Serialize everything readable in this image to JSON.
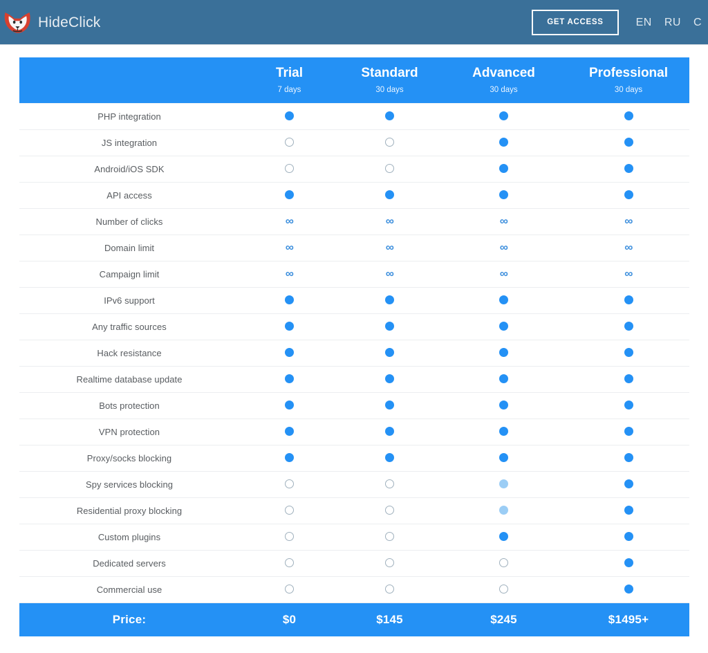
{
  "navbar": {
    "brand_name": "HideClick",
    "logo_icon": "fox-head-logo-icon",
    "cta_label": "GET ACCESS",
    "languages": [
      "EN",
      "RU",
      "C"
    ],
    "background_color": "#3a7099"
  },
  "pricing_table": {
    "accent_color": "#2491f5",
    "partial_color": "#9bcdf5",
    "empty_marker_color": "#9fb0bd",
    "feature_column_header": "",
    "plans": [
      {
        "name": "Trial",
        "duration": "7 days",
        "price": "$0"
      },
      {
        "name": "Standard",
        "duration": "30 days",
        "price": "$145"
      },
      {
        "name": "Advanced",
        "duration": "30 days",
        "price": "$245"
      },
      {
        "name": "Professional",
        "duration": "30 days",
        "price": "$1495+"
      }
    ],
    "price_row_label": "Price:",
    "marker_legend": {
      "full": "included",
      "partial": "partially included",
      "empty": "not included",
      "infinity": "unlimited"
    },
    "rows": [
      {
        "feature": "PHP integration",
        "values": [
          "full",
          "full",
          "full",
          "full"
        ]
      },
      {
        "feature": "JS integration",
        "values": [
          "empty",
          "empty",
          "full",
          "full"
        ]
      },
      {
        "feature": "Android/iOS SDK",
        "values": [
          "empty",
          "empty",
          "full",
          "full"
        ]
      },
      {
        "feature": "API access",
        "values": [
          "full",
          "full",
          "full",
          "full"
        ]
      },
      {
        "feature": "Number of clicks",
        "values": [
          "infinity",
          "infinity",
          "infinity",
          "infinity"
        ]
      },
      {
        "feature": "Domain limit",
        "values": [
          "infinity",
          "infinity",
          "infinity",
          "infinity"
        ]
      },
      {
        "feature": "Campaign limit",
        "values": [
          "infinity",
          "infinity",
          "infinity",
          "infinity"
        ]
      },
      {
        "feature": "IPv6 support",
        "values": [
          "full",
          "full",
          "full",
          "full"
        ]
      },
      {
        "feature": "Any traffic sources",
        "values": [
          "full",
          "full",
          "full",
          "full"
        ]
      },
      {
        "feature": "Hack resistance",
        "values": [
          "full",
          "full",
          "full",
          "full"
        ]
      },
      {
        "feature": "Realtime database update",
        "values": [
          "full",
          "full",
          "full",
          "full"
        ]
      },
      {
        "feature": "Bots protection",
        "values": [
          "full",
          "full",
          "full",
          "full"
        ]
      },
      {
        "feature": "VPN protection",
        "values": [
          "full",
          "full",
          "full",
          "full"
        ]
      },
      {
        "feature": "Proxy/socks blocking",
        "values": [
          "full",
          "full",
          "full",
          "full"
        ]
      },
      {
        "feature": "Spy services blocking",
        "values": [
          "empty",
          "empty",
          "partial",
          "full"
        ]
      },
      {
        "feature": "Residential proxy blocking",
        "values": [
          "empty",
          "empty",
          "partial",
          "full"
        ]
      },
      {
        "feature": "Custom plugins",
        "values": [
          "empty",
          "empty",
          "full",
          "full"
        ]
      },
      {
        "feature": "Dedicated servers",
        "values": [
          "empty",
          "empty",
          "empty",
          "full"
        ]
      },
      {
        "feature": "Commercial use",
        "values": [
          "empty",
          "empty",
          "empty",
          "full"
        ]
      }
    ]
  }
}
